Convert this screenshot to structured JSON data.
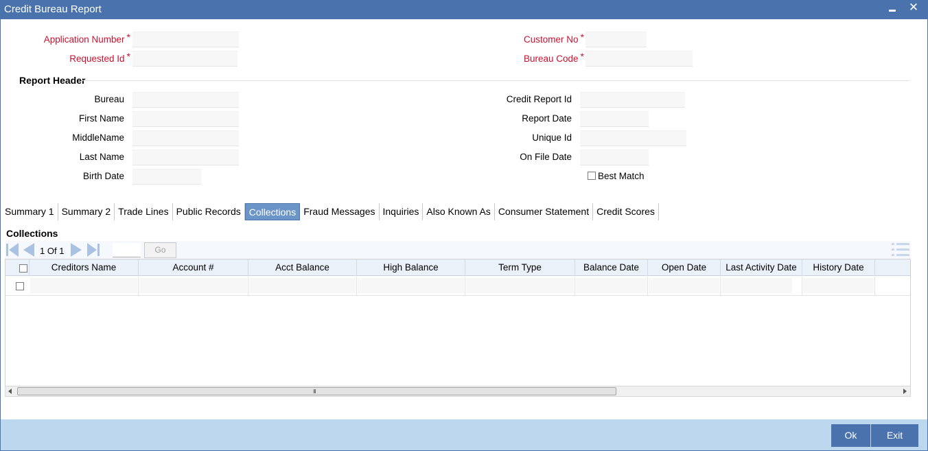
{
  "window": {
    "title": "Credit Bureau Report",
    "minimize_label": "",
    "close_label": "✕"
  },
  "header_fields": {
    "application_number": {
      "label": "Application Number",
      "required": "*",
      "value": ""
    },
    "requested_id": {
      "label": "Requested Id",
      "required": "*",
      "value": ""
    },
    "customer_no": {
      "label": "Customer No",
      "required": "*",
      "value": ""
    },
    "bureau_code": {
      "label": "Bureau Code",
      "required": "*",
      "value": ""
    }
  },
  "report_header": {
    "title": "Report Header",
    "bureau": {
      "label": "Bureau",
      "value": ""
    },
    "first_name": {
      "label": "First Name",
      "value": ""
    },
    "middle_name": {
      "label": "MiddleName",
      "value": ""
    },
    "last_name": {
      "label": "Last Name",
      "value": ""
    },
    "birth_date": {
      "label": "Birth Date",
      "value": ""
    },
    "credit_report_id": {
      "label": "Credit Report Id",
      "value": ""
    },
    "report_date": {
      "label": "Report Date",
      "value": ""
    },
    "unique_id": {
      "label": "Unique Id",
      "value": ""
    },
    "on_file_date": {
      "label": "On File Date",
      "value": ""
    },
    "best_match": {
      "label": "Best Match",
      "checked": false
    }
  },
  "tabs": [
    {
      "label": "Summary 1",
      "active": false
    },
    {
      "label": "Summary 2",
      "active": false
    },
    {
      "label": "Trade Lines",
      "active": false
    },
    {
      "label": "Public Records",
      "active": false
    },
    {
      "label": "Collections",
      "active": true
    },
    {
      "label": "Fraud Messages",
      "active": false
    },
    {
      "label": "Inquiries",
      "active": false
    },
    {
      "label": "Also Known As",
      "active": false
    },
    {
      "label": "Consumer Statement",
      "active": false
    },
    {
      "label": "Credit Scores",
      "active": false
    }
  ],
  "collections": {
    "title": "Collections",
    "pagination": {
      "current": "1",
      "of_label": "Of",
      "total": "1",
      "page_input": "",
      "go_label": "Go"
    },
    "columns": [
      "Creditors Name",
      "Account #",
      "Acct Balance",
      "High Balance",
      "Term Type",
      "Balance Date",
      "Open Date",
      "Last Activity Date",
      "History Date"
    ],
    "rows": [
      {
        "creditors_name": "",
        "account": "",
        "acct_balance": "",
        "high_balance": "",
        "term_type": "",
        "balance_date": "",
        "open_date": "",
        "last_activity_date": "",
        "history_date": ""
      }
    ],
    "scrollbar_grip": "III"
  },
  "footer": {
    "ok_label": "Ok",
    "exit_label": "Exit"
  },
  "colors": {
    "titlebar": "#4a73ae",
    "required": "#c8102e",
    "active_tab": "#6b94c8",
    "footer": "#bdd7ee",
    "button": "#4a73ae"
  }
}
